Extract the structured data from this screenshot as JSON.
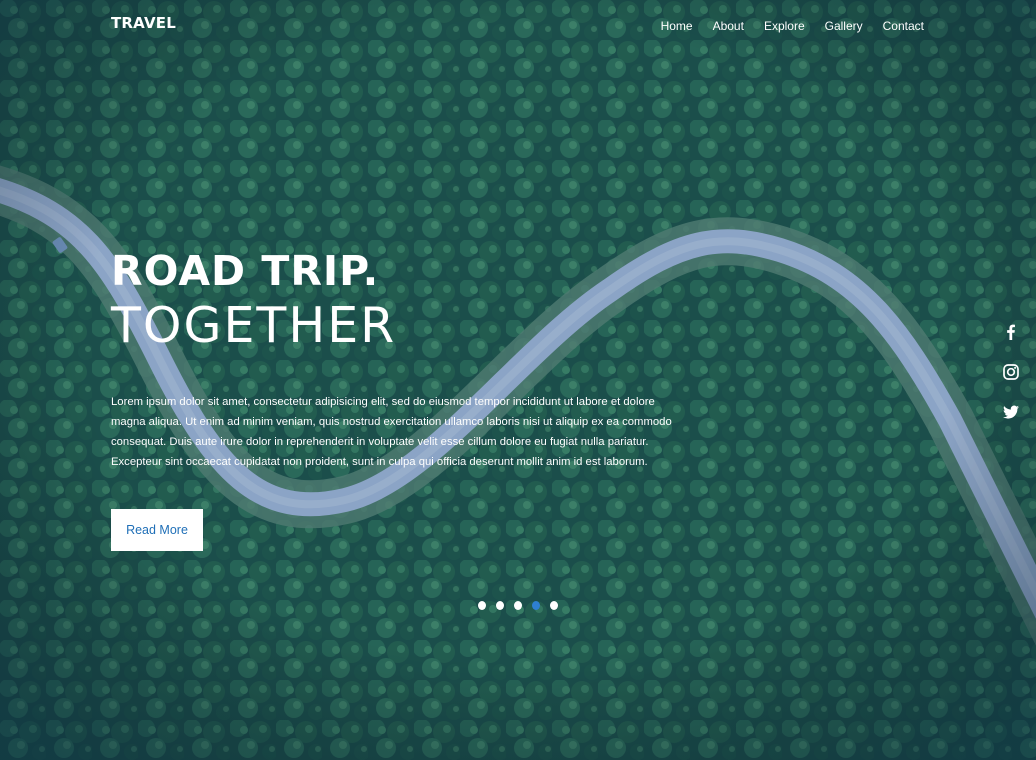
{
  "header": {
    "brand": "TRAVEL",
    "nav": [
      "Home",
      "About",
      "Explore",
      "Gallery",
      "Contact"
    ]
  },
  "hero": {
    "title_line1": "ROAD TRIP.",
    "title_line2": "TOGETHER",
    "paragraph": "Lorem ipsum dolor sit amet, consectetur adipisicing elit, sed do eiusmod tempor incididunt ut labore et dolore magna aliqua. Ut enim ad minim veniam, quis nostrud exercitation ullamco laboris nisi ut aliquip ex ea commodo consequat. Duis aute irure dolor in reprehenderit in voluptate velit esse cillum dolore eu fugiat nulla pariatur. Excepteur sint occaecat cupidatat non proident, sunt in culpa qui officia deserunt mollit anim id est laborum.",
    "button_label": "Read More"
  },
  "slider": {
    "count": 5,
    "active_index": 3
  },
  "social": [
    "facebook-icon",
    "instagram-icon",
    "twitter-icon"
  ],
  "colors": {
    "accent": "#2e7fd0",
    "button_text": "#1f6fb7",
    "forest": "#1e5a46",
    "road": "#9fb6d6"
  }
}
